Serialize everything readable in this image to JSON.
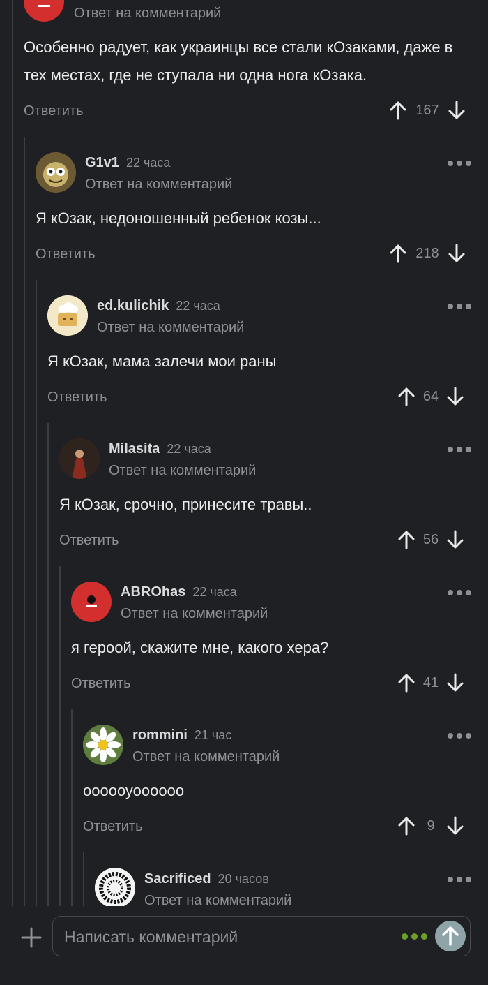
{
  "thread": {
    "top_comment": {
      "reply_note": "Ответ на комментарий",
      "text": "Особенно радует, как украинцы все стали кОзаками, даже в тех местах, где не ступала ни одна нога кОзака.",
      "reply_label": "Ответить",
      "votes": "167"
    },
    "comments": [
      {
        "username": "G1v1",
        "time": "22 часа",
        "reply_note": "Ответ на комментарий",
        "text": "Я кОзак, недоношенный ребенок козы...",
        "reply_label": "Ответить",
        "votes": "218"
      },
      {
        "username": "ed.kulichik",
        "time": "22 часа",
        "reply_note": "Ответ на комментарий",
        "text": "Я кОзак, мама залечи мои раны",
        "reply_label": "Ответить",
        "votes": "64"
      },
      {
        "username": "Milasita",
        "time": "22 часа",
        "reply_note": "Ответ на комментарий",
        "text": "Я кОзак, срочно, принесите травы..",
        "reply_label": "Ответить",
        "votes": "56"
      },
      {
        "username": "ABROhas",
        "time": "22 часа",
        "reply_note": "Ответ на комментарий",
        "text": "я героой, скажите мне, какого хера?",
        "reply_label": "Ответить",
        "votes": "41"
      },
      {
        "username": "rommini",
        "time": "21 час",
        "reply_note": "Ответ на комментарий",
        "text": "оооооуоооооо",
        "reply_label": "Ответить",
        "votes": "9"
      },
      {
        "username": "Sacrificed",
        "time": "20 часов",
        "reply_note": "Ответ на комментарий"
      }
    ]
  },
  "composer": {
    "placeholder": "Написать комментарий"
  },
  "colors": {
    "background": "#1e2023",
    "muted_text": "#8e9095",
    "accent_green": "#6aa026",
    "avatar_red": "#d32f2f"
  }
}
